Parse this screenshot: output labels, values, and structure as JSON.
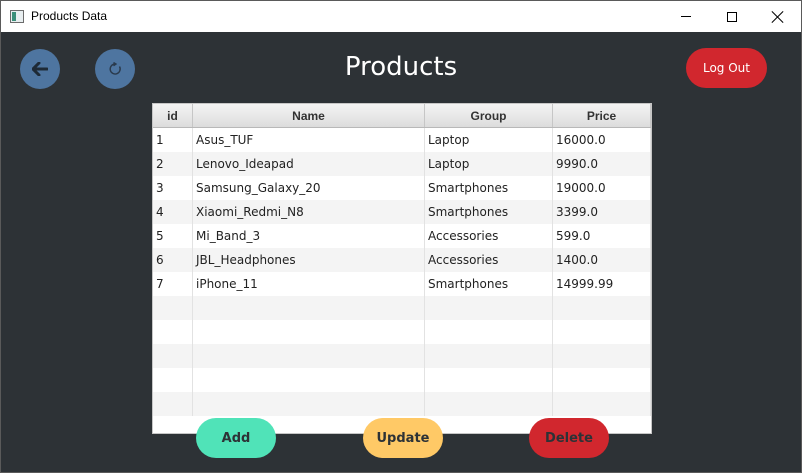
{
  "window": {
    "title": "Products Data"
  },
  "header": {
    "title": "Products",
    "logout_label": "Log Out"
  },
  "icons": {
    "back": "arrow-left-icon",
    "refresh": "refresh-icon"
  },
  "table": {
    "columns": [
      "id",
      "Name",
      "Group",
      "Price"
    ],
    "rows": [
      [
        "1",
        "Asus_TUF",
        "Laptop",
        "16000.0"
      ],
      [
        "2",
        "Lenovo_Ideapad",
        "Laptop",
        "9990.0"
      ],
      [
        "3",
        "Samsung_Galaxy_20",
        "Smartphones",
        "19000.0"
      ],
      [
        "4",
        "Xiaomi_Redmi_N8",
        "Smartphones",
        "3399.0"
      ],
      [
        "5",
        "Mi_Band_3",
        "Accessories",
        "599.0"
      ],
      [
        "6",
        "JBL_Headphones",
        "Accessories",
        "1400.0"
      ],
      [
        "7",
        "iPhone_11",
        "Smartphones",
        "14999.99"
      ]
    ],
    "empty_rows": 5
  },
  "actions": {
    "add_label": "Add",
    "update_label": "Update",
    "delete_label": "Delete"
  },
  "colors": {
    "background": "#2d3236",
    "nav_button": "#4e75a0",
    "logout": "#d1272e",
    "add": "#50e3b8",
    "update": "#ffc966",
    "delete": "#d1272e"
  }
}
